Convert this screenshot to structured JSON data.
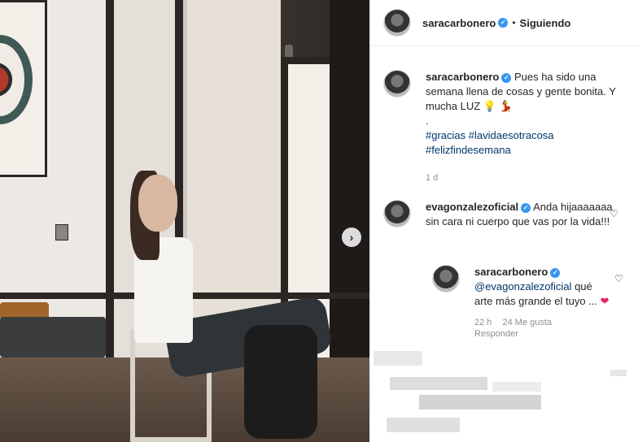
{
  "post": {
    "username": "saracarbonero",
    "follow_status": "Siguiendo",
    "more_icon": "ellipsis-icon"
  },
  "caption": {
    "username": "saracarbonero",
    "text_line1": "Pues ha sido una semana llena de cosas y gente bonita. Y mucha LUZ",
    "emoji1": "💡",
    "emoji2": "💃",
    "dot_line": ".",
    "hashtags_line1": "#gracias #lavidaesotracosa",
    "hashtags_line2": "#felizfindesemana",
    "time": "1 d"
  },
  "comments": [
    {
      "username": "evagonzalezoficial",
      "text": "Anda hijaaaaaaa sin cara ni cuerpo que vas por la vida!!!"
    }
  ],
  "reply": {
    "username": "saracarbonero",
    "mention": "@evagonzalezoficial",
    "text": "qué arte más grande el tuyo ...",
    "emoji": "❤",
    "time": "22 h",
    "likes": "24 Me gusta",
    "reply_label": "Responder"
  },
  "icons": {
    "next": "›"
  },
  "colors": {
    "verified": "#3897f0",
    "link": "#00376b",
    "secondary_text": "#8e8e8e"
  }
}
